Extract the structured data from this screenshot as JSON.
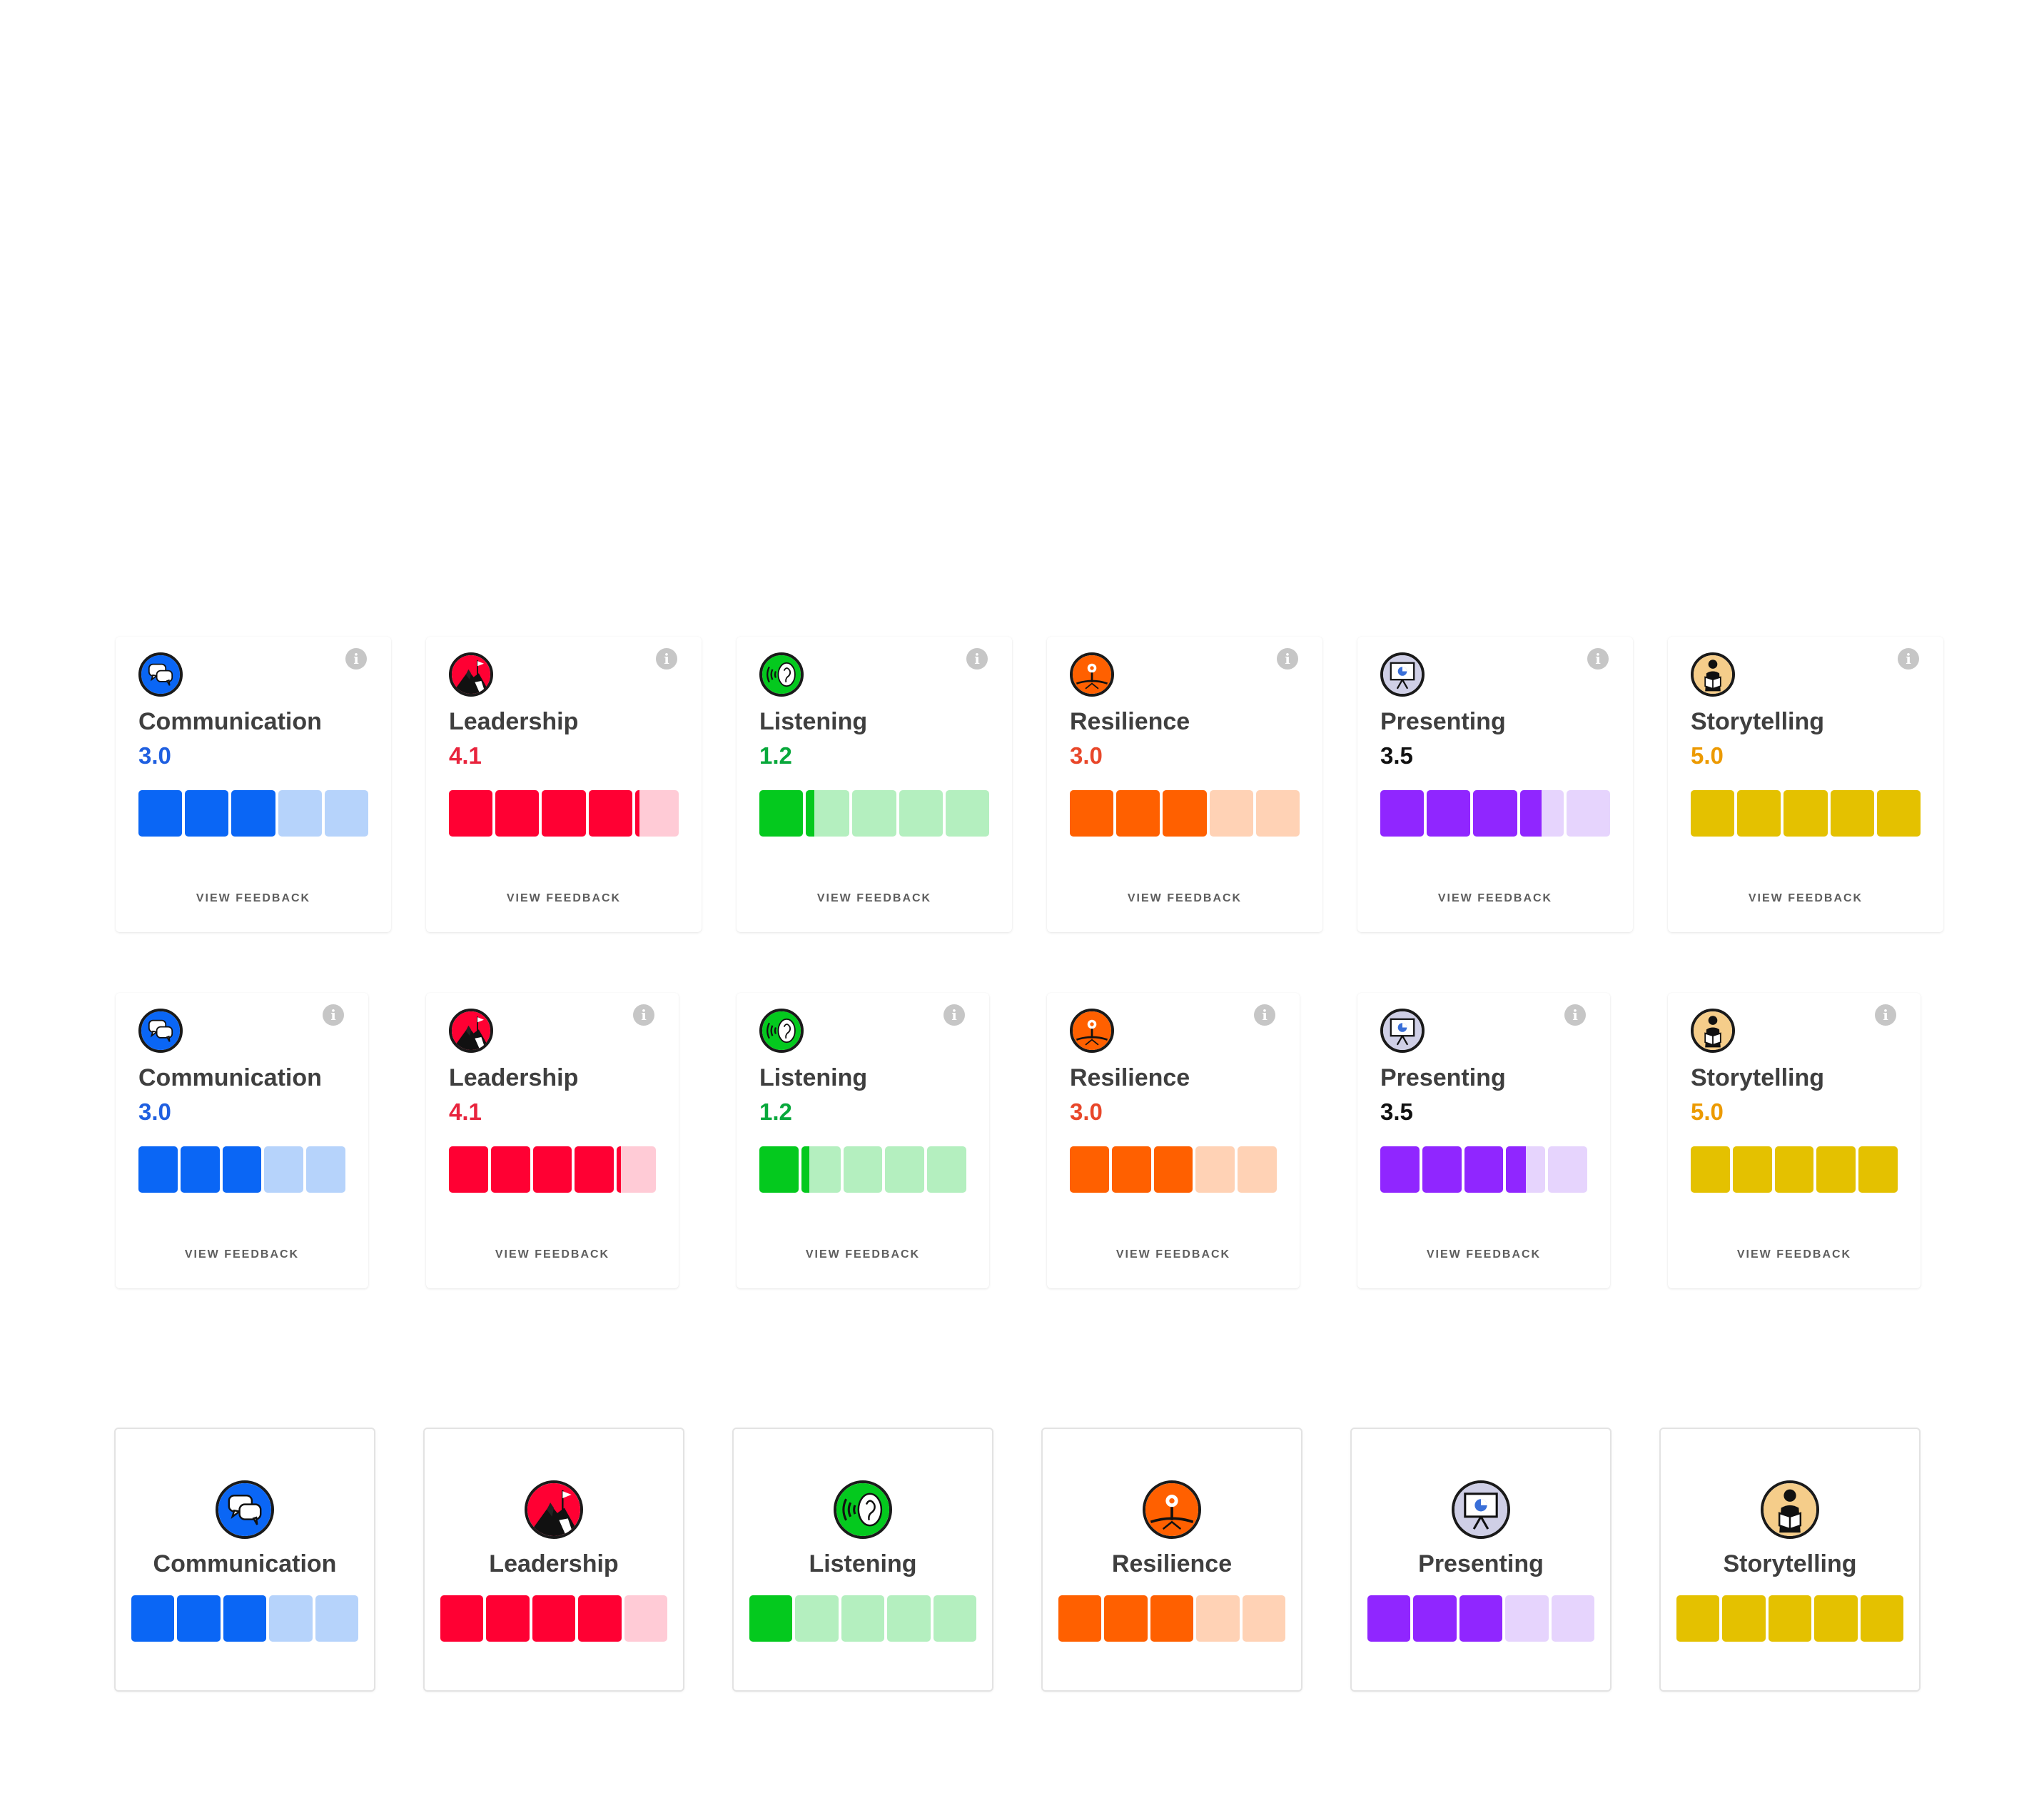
{
  "feedback_label": "VIEW FEEDBACK",
  "skills": [
    {
      "key": "communication",
      "name": "Communication",
      "score": "3.0",
      "level": 3.0,
      "color": "#0a66f5",
      "light": "#b6d3fb",
      "score_color": "#1f5fe0",
      "icon": "speech-bubbles-icon"
    },
    {
      "key": "leadership",
      "name": "Leadership",
      "score": "4.1",
      "level": 4.1,
      "color": "#ff0033",
      "light": "#ffcbd6",
      "score_color": "#e8243d",
      "icon": "flag-climber-icon"
    },
    {
      "key": "listening",
      "name": "Listening",
      "score": "1.2",
      "level": 1.2,
      "color": "#04c91e",
      "light": "#b4efbf",
      "score_color": "#08a83b",
      "icon": "ear-icon"
    },
    {
      "key": "resilience",
      "name": "Resilience",
      "score": "3.0",
      "level": 3.0,
      "color": "#ff6000",
      "light": "#ffd2b5",
      "score_color": "#e8472a",
      "icon": "sprout-flower-icon"
    },
    {
      "key": "presenting",
      "name": "Presenting",
      "score": "3.5",
      "level": 3.5,
      "color": "#9026ff",
      "light": "#e6d4fd",
      "score_color": "#111111",
      "icon": "presentation-board-icon"
    },
    {
      "key": "storytelling",
      "name": "Storytelling",
      "score": "5.0",
      "level": 5.0,
      "color": "#e4c100",
      "light": "#f7eaa0",
      "score_color": "#ec9a00",
      "icon": "reading-person-icon"
    }
  ],
  "compact_levels": [
    3,
    4,
    1,
    3,
    3,
    5
  ]
}
